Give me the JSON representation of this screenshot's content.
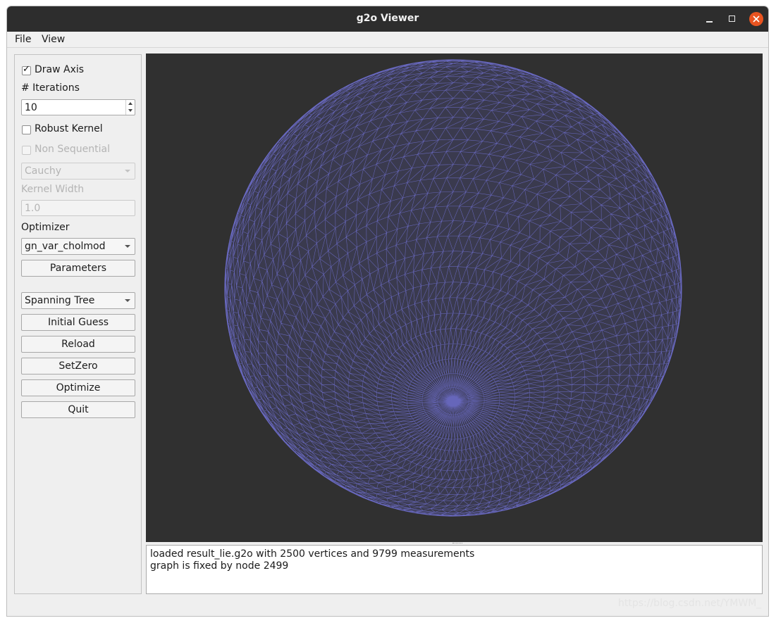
{
  "window": {
    "title": "g2o Viewer"
  },
  "menu": {
    "file": "File",
    "view": "View"
  },
  "panel": {
    "draw_axis": {
      "label": "Draw Axis",
      "checked": true,
      "check_glyph": "✓"
    },
    "iterations": {
      "label": "# Iterations",
      "value": "10"
    },
    "robust_kernel": {
      "label": "Robust Kernel",
      "checked": false
    },
    "non_sequential": {
      "label": "Non Sequential",
      "checked": false
    },
    "kernel_type": {
      "value": "Cauchy"
    },
    "kernel_width": {
      "label": "Kernel Width",
      "value": "1.0"
    },
    "optimizer": {
      "label": "Optimizer",
      "value": "gn_var_cholmod"
    },
    "parameters_button": "Parameters",
    "init_method": {
      "value": "Spanning Tree"
    },
    "initial_guess_button": "Initial Guess",
    "reload_button": "Reload",
    "setzero_button": "SetZero",
    "optimize_button": "Optimize",
    "quit_button": "Quit"
  },
  "viewer": {
    "background": "#303030",
    "mesh_color": "#6b6bc6"
  },
  "log": {
    "lines": [
      "loaded result_lie.g2o with 2500 vertices and 9799 measurements",
      "graph is fixed by node 2499"
    ]
  },
  "watermark": "https://blog.csdn.net/YMWM_"
}
